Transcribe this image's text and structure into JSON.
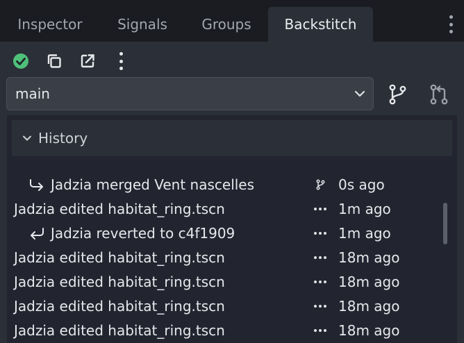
{
  "tabs": [
    {
      "label": "Inspector",
      "active": false
    },
    {
      "label": "Signals",
      "active": false
    },
    {
      "label": "Groups",
      "active": false
    },
    {
      "label": "Backstitch",
      "active": true
    }
  ],
  "toolbar": {
    "status_icon": "check-circle-icon",
    "copy_icon": "copy-icon",
    "open_external_icon": "external-link-icon",
    "more_icon": "vertical-dots-icon",
    "status_color": "#4ec07a"
  },
  "branch": {
    "selected": "main",
    "branch_icon": "git-branch-icon",
    "pull_request_icon": "git-pull-request-icon"
  },
  "history": {
    "title": "History",
    "items": [
      {
        "icon": "merge-arrow-icon",
        "message": "Jadzia merged Vent nascelles",
        "meta_icon": "git-branch-icon",
        "time": "0s ago"
      },
      {
        "icon": "",
        "message": "Jadzia edited habitat_ring.tscn",
        "meta_icon": "ellipsis-icon",
        "time": "1m ago"
      },
      {
        "icon": "revert-arrow-icon",
        "message": "Jadzia reverted to c4f1909",
        "meta_icon": "ellipsis-icon",
        "time": "1m ago"
      },
      {
        "icon": "",
        "message": "Jadzia edited habitat_ring.tscn",
        "meta_icon": "ellipsis-icon",
        "time": "18m ago"
      },
      {
        "icon": "",
        "message": "Jadzia edited habitat_ring.tscn",
        "meta_icon": "ellipsis-icon",
        "time": "18m ago"
      },
      {
        "icon": "",
        "message": "Jadzia edited habitat_ring.tscn",
        "meta_icon": "ellipsis-icon",
        "time": "18m ago"
      },
      {
        "icon": "",
        "message": "Jadzia edited habitat_ring.tscn",
        "meta_icon": "ellipsis-icon",
        "time": "18m ago"
      }
    ]
  }
}
